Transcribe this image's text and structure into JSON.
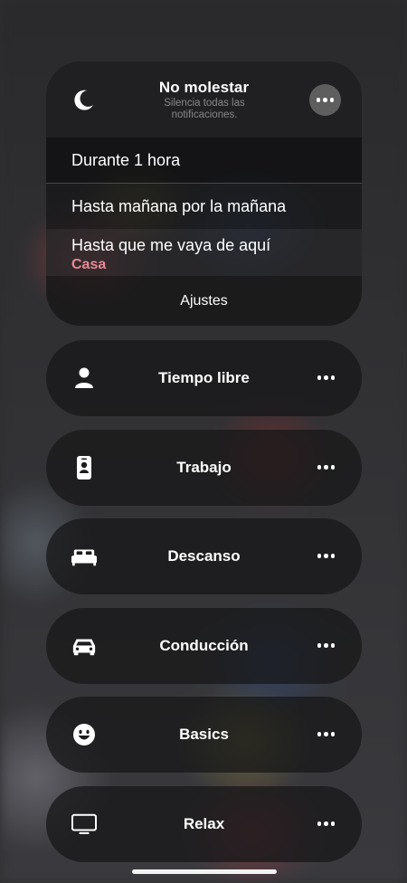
{
  "dnd": {
    "title": "No molestar",
    "subtitle": "Silencia todas las notificaciones.",
    "options": [
      {
        "label": "Durante 1 hora"
      },
      {
        "label": "Hasta mañana por la mañana"
      },
      {
        "label": "Hasta que me vaya de aquí",
        "sub": "Casa"
      }
    ],
    "settings_label": "Ajustes",
    "icon": "moon-icon"
  },
  "focus_modes": [
    {
      "label": "Tiempo libre",
      "icon": "person-icon"
    },
    {
      "label": "Trabajo",
      "icon": "id-badge-icon"
    },
    {
      "label": "Descanso",
      "icon": "bed-icon"
    },
    {
      "label": "Conducción",
      "icon": "car-icon"
    },
    {
      "label": "Basics",
      "icon": "smiley-icon"
    },
    {
      "label": "Relax",
      "icon": "tv-icon"
    }
  ],
  "colors": {
    "accent_location": "#e58a96"
  }
}
